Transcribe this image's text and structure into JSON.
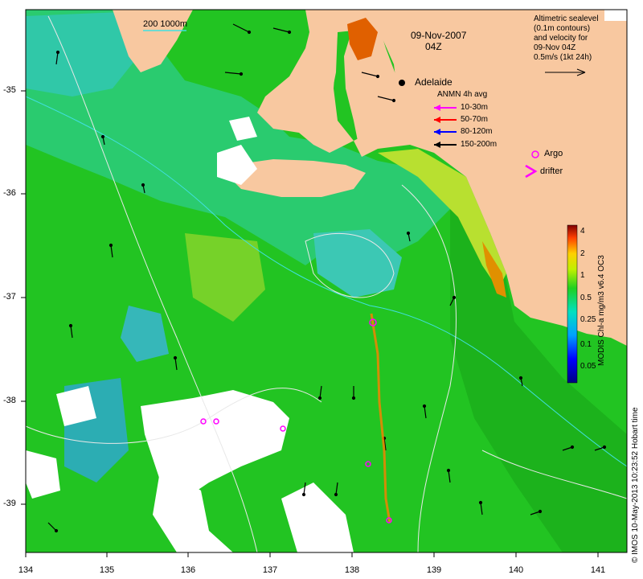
{
  "map": {
    "date": "09-Nov-2007",
    "time": "04Z",
    "city": "Adelaide",
    "contour_legend": "200  1000m",
    "sealevel_note": [
      "Altimetric sealevel",
      "(0.1m contours)",
      "and velocity for",
      "09-Nov 04Z",
      "0.5m/s (1kt 24h)"
    ],
    "anmn_title": "ANMN 4h avg",
    "anmn_items": [
      {
        "label": "10-30m",
        "color": "#ff00ff"
      },
      {
        "label": "50-70m",
        "color": "#ff0000"
      },
      {
        "label": "80-120m",
        "color": "#0000ff"
      },
      {
        "label": "150-200m",
        "color": "#000000"
      }
    ],
    "argo_label": "Argo",
    "drifter_label": "drifter",
    "x_ticks": [
      "134",
      "135",
      "136",
      "137",
      "138",
      "139",
      "140",
      "141"
    ],
    "y_ticks": [
      "-35",
      "-36",
      "-37",
      "-38",
      "-39"
    ],
    "colorbar": {
      "title": "MODIS Chl-a mg/m3 v6.4 OC3",
      "ticks": [
        "4",
        "2",
        "1",
        "0.5",
        "0.25",
        "0.1",
        "0.05"
      ]
    },
    "credit": "© IMOS 10-May-2013 10:23:52 Hobart time",
    "colors": {
      "land": "#f8c8a0",
      "ocean_green": "#22c822",
      "ocean_cyan": "#20c8b0",
      "cloud": "#ffffff",
      "contour": "#e8e8e8",
      "shelf": "#40e0e0"
    }
  }
}
